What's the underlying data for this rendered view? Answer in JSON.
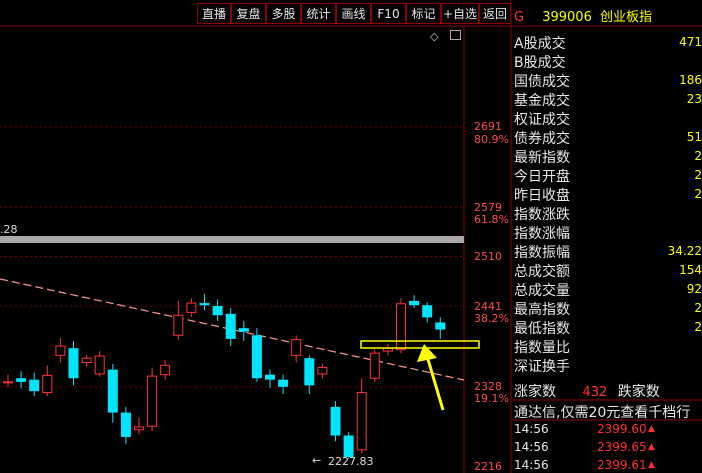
{
  "toolbar": {
    "buttons": [
      "直播",
      "复盘",
      "多股",
      "统计",
      "画线",
      "F10",
      "标记",
      "+自选",
      "返回"
    ]
  },
  "chart": {
    "title_code": "G",
    "index_code": "399006",
    "index_name": "创业板指",
    "upper_left_label": ".28",
    "price_labels": [
      "2691",
      "2579",
      "2510",
      "2441",
      "2328",
      "2216"
    ],
    "fib_labels": [
      "80.9%",
      "61.8%",
      "38.2%",
      "19.1%"
    ],
    "low_annotation": "2227.83"
  },
  "side": {
    "rows": [
      {
        "label": "A股成交",
        "value": "471"
      },
      {
        "label": "B股成交",
        "value": ""
      },
      {
        "label": "国债成交",
        "value": "186"
      },
      {
        "label": "基金成交",
        "value": "23"
      },
      {
        "label": "权证成交",
        "value": ""
      },
      {
        "label": "债券成交",
        "value": "51"
      },
      {
        "label": "最新指数",
        "value": "2"
      },
      {
        "label": "今日开盘",
        "value": "2"
      },
      {
        "label": "昨日收盘",
        "value": "2"
      },
      {
        "label": "指数涨跌",
        "value": ""
      },
      {
        "label": "指数涨幅",
        "value": ""
      },
      {
        "label": "指数振幅",
        "value": "34.22"
      },
      {
        "label": "总成交额",
        "value": "154"
      },
      {
        "label": "总成交量",
        "value": "92"
      },
      {
        "label": "最高指数",
        "value": "2"
      },
      {
        "label": "最低指数",
        "value": "2"
      },
      {
        "label": "指数量比",
        "value": ""
      },
      {
        "label": "深证换手",
        "value": ""
      }
    ],
    "rise_label": "涨家数",
    "rise_count": "432",
    "fall_label": "跌家数",
    "promo": "通达信,仅需20元查看千档行",
    "ticks": [
      {
        "time": "14:56",
        "price": "2399.60"
      },
      {
        "time": "14:56",
        "price": "2399.65"
      },
      {
        "time": "14:56",
        "price": "2399.61"
      }
    ]
  },
  "colors": {
    "up": "#ff3232",
    "down": "#00e5ff",
    "grid": "#7a0000",
    "label_red": "#ff4a4a",
    "value_yellow": "#ffff00",
    "trend_line": "#ff9999",
    "annotation": "#ffff00"
  },
  "chart_data": {
    "type": "candlestick",
    "y_range": [
      2216,
      2700
    ],
    "candles": [
      {
        "o": 2335,
        "c": 2335,
        "h": 2345,
        "l": 2328
      },
      {
        "o": 2340,
        "c": 2335,
        "h": 2350,
        "l": 2326
      },
      {
        "o": 2338,
        "c": 2322,
        "h": 2348,
        "l": 2315
      },
      {
        "o": 2320,
        "c": 2344,
        "h": 2358,
        "l": 2315
      },
      {
        "o": 2372,
        "c": 2385,
        "h": 2396,
        "l": 2362
      },
      {
        "o": 2382,
        "c": 2340,
        "h": 2392,
        "l": 2330
      },
      {
        "o": 2362,
        "c": 2368,
        "h": 2372,
        "l": 2356
      },
      {
        "o": 2346,
        "c": 2371,
        "h": 2378,
        "l": 2342
      },
      {
        "o": 2352,
        "c": 2292,
        "h": 2360,
        "l": 2278
      },
      {
        "o": 2292,
        "c": 2258,
        "h": 2300,
        "l": 2248
      },
      {
        "o": 2268,
        "c": 2272,
        "h": 2285,
        "l": 2262
      },
      {
        "o": 2273,
        "c": 2343,
        "h": 2355,
        "l": 2266
      },
      {
        "o": 2345,
        "c": 2358,
        "h": 2365,
        "l": 2338
      },
      {
        "o": 2400,
        "c": 2428,
        "h": 2448,
        "l": 2394
      },
      {
        "o": 2432,
        "c": 2445,
        "h": 2452,
        "l": 2426
      },
      {
        "o": 2445,
        "c": 2442,
        "h": 2458,
        "l": 2435
      },
      {
        "o": 2441,
        "c": 2428,
        "h": 2450,
        "l": 2420
      },
      {
        "o": 2430,
        "c": 2395,
        "h": 2438,
        "l": 2385
      },
      {
        "o": 2410,
        "c": 2405,
        "h": 2420,
        "l": 2392
      },
      {
        "o": 2400,
        "c": 2340,
        "h": 2410,
        "l": 2335
      },
      {
        "o": 2345,
        "c": 2338,
        "h": 2352,
        "l": 2326
      },
      {
        "o": 2338,
        "c": 2328,
        "h": 2345,
        "l": 2318
      },
      {
        "o": 2372,
        "c": 2394,
        "h": 2400,
        "l": 2362
      },
      {
        "o": 2368,
        "c": 2330,
        "h": 2372,
        "l": 2318
      },
      {
        "o": 2346,
        "c": 2355,
        "h": 2360,
        "l": 2340
      },
      {
        "o": 2300,
        "c": 2260,
        "h": 2308,
        "l": 2252
      },
      {
        "o": 2260,
        "c": 2230,
        "h": 2265,
        "l": 2228
      },
      {
        "o": 2240,
        "c": 2320,
        "h": 2340,
        "l": 2235
      },
      {
        "o": 2340,
        "c": 2375,
        "h": 2380,
        "l": 2335
      },
      {
        "o": 2378,
        "c": 2382,
        "h": 2388,
        "l": 2372
      },
      {
        "o": 2380,
        "c": 2444,
        "h": 2452,
        "l": 2375
      },
      {
        "o": 2448,
        "c": 2442,
        "h": 2456,
        "l": 2438
      },
      {
        "o": 2442,
        "c": 2425,
        "h": 2446,
        "l": 2418
      },
      {
        "o": 2418,
        "c": 2408,
        "h": 2425,
        "l": 2395
      }
    ]
  }
}
